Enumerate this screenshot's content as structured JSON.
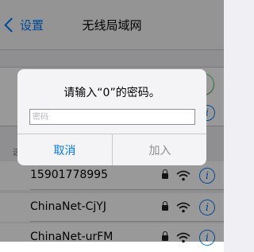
{
  "navbar": {
    "back_label": "设置",
    "title": "无线局域网"
  },
  "section": {
    "label": "选"
  },
  "networks": [
    {
      "name": "15901778995"
    },
    {
      "name": "ChinaNet-CjYJ"
    },
    {
      "name": "ChinaNet-urFM"
    }
  ],
  "dialog": {
    "title": "请输入“0”的密码。",
    "input_placeholder": "密码",
    "input_value": "",
    "cancel_label": "取消",
    "join_label": "加入"
  },
  "icons": {
    "lock": "lock-icon",
    "wifi": "wifi-icon",
    "info": "info-icon",
    "back": "chevron-left-icon"
  },
  "colors": {
    "accent": "#007aff",
    "toggle_on": "#4cd964",
    "disabled": "#8e8e93"
  },
  "wifi_toggle_on": true
}
